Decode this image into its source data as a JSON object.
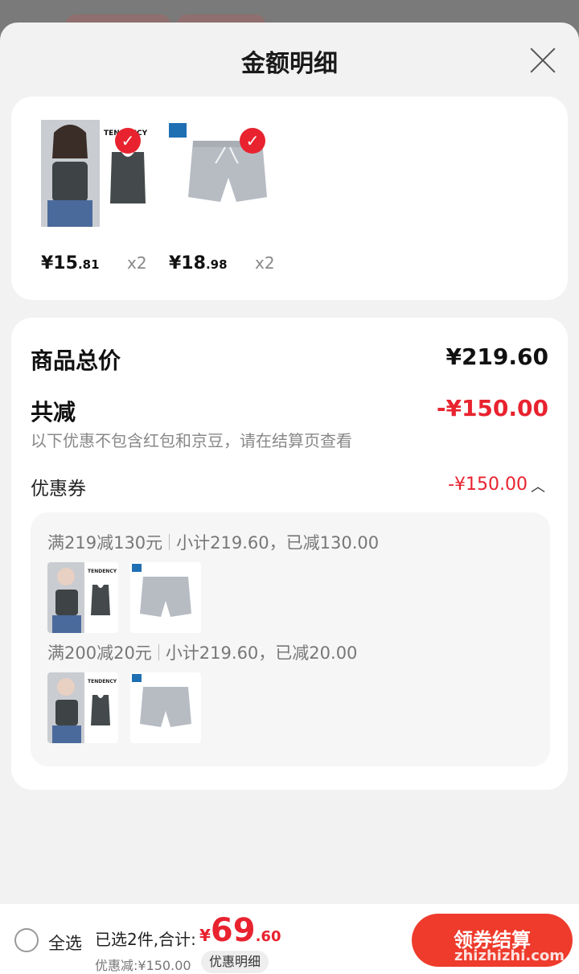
{
  "sheet": {
    "title": "金额明细"
  },
  "products": [
    {
      "price_main": "¥15",
      "price_dec": ".81",
      "qty": "x2",
      "brand": "TENDENCY"
    },
    {
      "price_main": "¥18",
      "price_dec": ".98",
      "qty": "x2"
    }
  ],
  "summary": {
    "total_label": "商品总价",
    "total_value": "¥219.60",
    "reduce_label": "共减",
    "reduce_value": "-¥150.00",
    "note": "以下优惠不包含红包和京豆，请在结算页查看",
    "coupon_label": "优惠券",
    "coupon_value": "-¥150.00"
  },
  "coupons": [
    {
      "rule": "满219减130元",
      "detail": "小计219.60，已减130.00",
      "brand": "TENDENCY"
    },
    {
      "rule": "满200减20元",
      "detail": "小计219.60，已减20.00",
      "brand": "TENDENCY"
    }
  ],
  "bottom": {
    "select_all": "全选",
    "selected_text": "已选2件,合计:",
    "total_currency": "¥",
    "total_int": "69",
    "total_dec": ".60",
    "discount_text": "优惠减:¥150.00",
    "detail_button": "优惠明细",
    "checkout_button": "领券结算",
    "watermark": "zhizhizhi.com"
  },
  "colors": {
    "accent": "#e8232f",
    "background": "#f2f2f2"
  }
}
